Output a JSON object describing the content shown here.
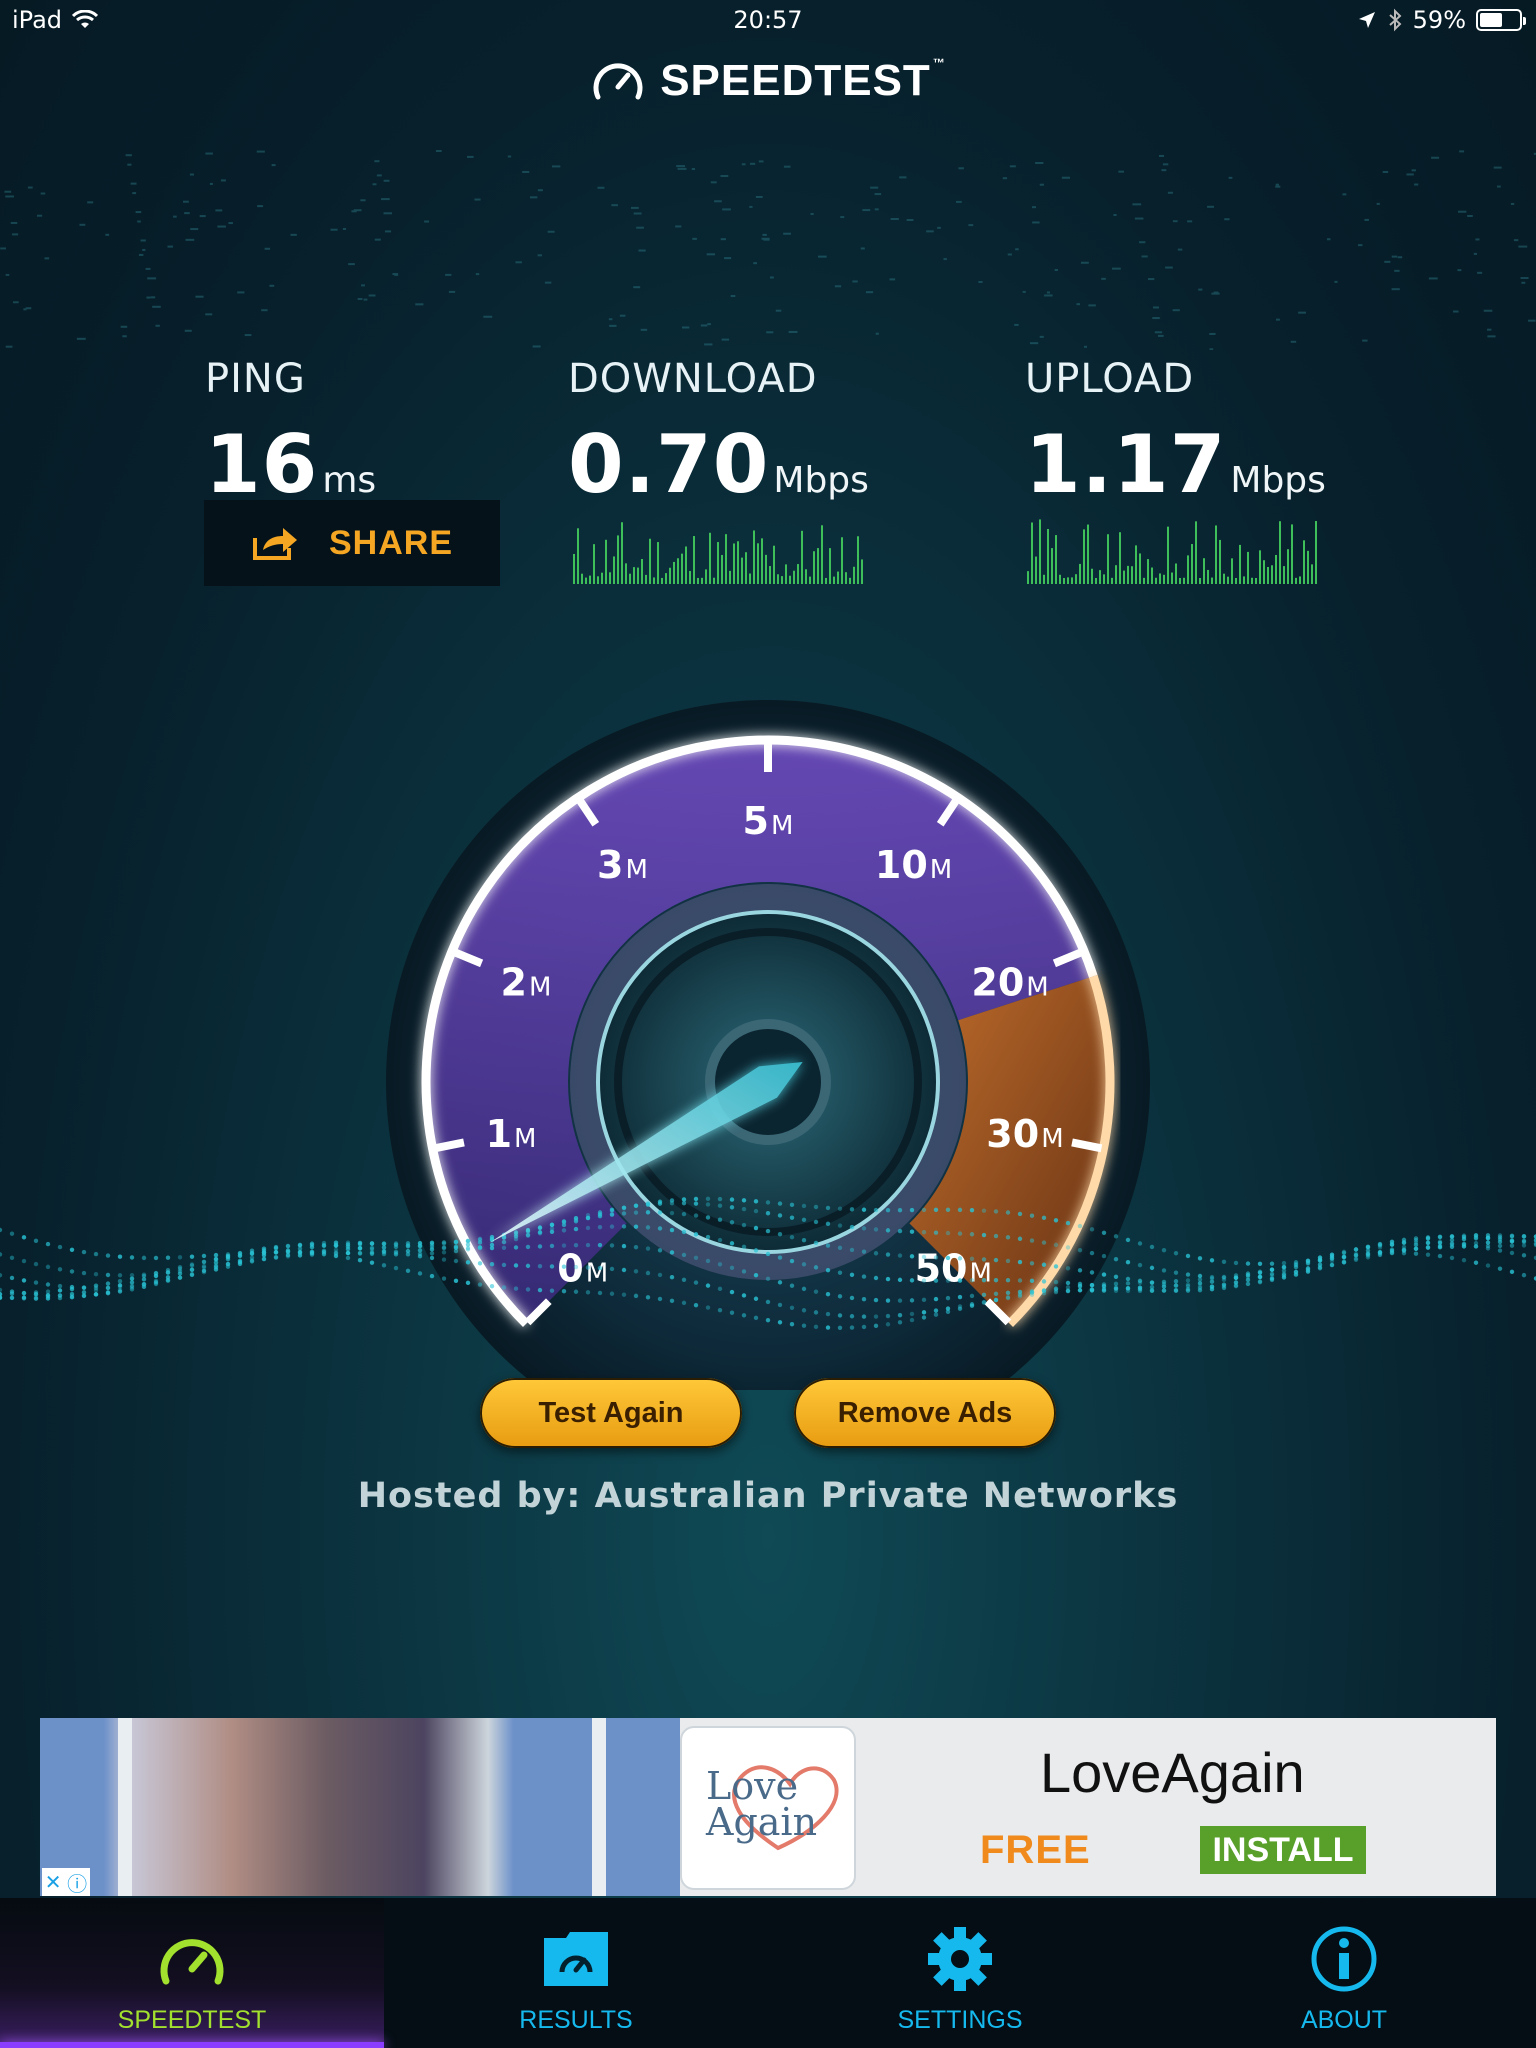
{
  "status_bar": {
    "device": "iPad",
    "time": "20:57",
    "battery": "59%",
    "battery_level": 0.59
  },
  "header": {
    "title": "SPEEDTEST",
    "trademark": "™"
  },
  "metrics": {
    "ping": {
      "label": "PING",
      "value": "16",
      "unit": "ms"
    },
    "download": {
      "label": "DOWNLOAD",
      "value": "0.70",
      "unit": "Mbps"
    },
    "upload": {
      "label": "UPLOAD",
      "value": "1.17",
      "unit": "Mbps"
    }
  },
  "share": {
    "label": "SHARE"
  },
  "gauge": {
    "ticks": [
      {
        "value": "0",
        "unit": "M"
      },
      {
        "value": "1",
        "unit": "M"
      },
      {
        "value": "2",
        "unit": "M"
      },
      {
        "value": "3",
        "unit": "M"
      },
      {
        "value": "5",
        "unit": "M"
      },
      {
        "value": "10",
        "unit": "M"
      },
      {
        "value": "20",
        "unit": "M"
      },
      {
        "value": "30",
        "unit": "M"
      },
      {
        "value": "50",
        "unit": "M"
      }
    ]
  },
  "actions": {
    "test_again": "Test Again",
    "remove_ads": "Remove Ads"
  },
  "hosted_by": "Hosted by: Australian Private Networks",
  "ad": {
    "logo_text_line1": "Love",
    "logo_text_line2": "Again",
    "title": "LoveAgain",
    "free": "FREE",
    "install": "INSTALL"
  },
  "tabs": [
    {
      "label": "SPEEDTEST",
      "icon": "speedometer-icon"
    },
    {
      "label": "RESULTS",
      "icon": "results-folder-icon"
    },
    {
      "label": "SETTINGS",
      "icon": "gear-icon"
    },
    {
      "label": "ABOUT",
      "icon": "info-icon"
    }
  ],
  "colors": {
    "accent_orange": "#f5a623",
    "accent_green": "#a2e12d",
    "accent_blue": "#16b9ee",
    "accent_purple": "#8a3cff"
  }
}
